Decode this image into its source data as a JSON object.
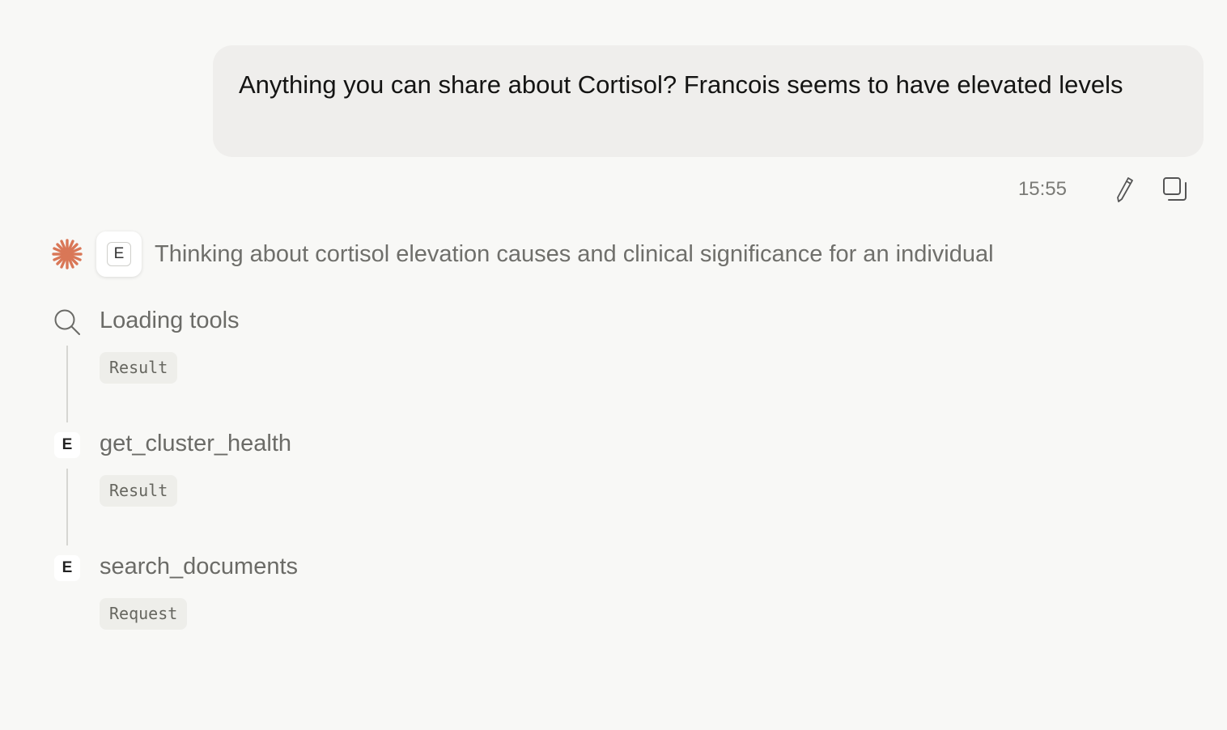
{
  "user_message": {
    "text": "Anything you can share about Cortisol? Francois seems to have elevated levels",
    "timestamp": "15:55",
    "icons": {
      "edit": "pencil-icon",
      "copy": "copy-icon"
    }
  },
  "assistant": {
    "thinking_icon_letter": "E",
    "thinking_text": "Thinking about cortisol elevation causes and clinical significance for an individual",
    "accent_color": "#d97757",
    "steps": [
      {
        "icon": "search-icon",
        "title": "Loading tools",
        "chip": "Result"
      },
      {
        "icon": "e-badge-icon",
        "icon_letter": "E",
        "title": "get_cluster_health",
        "chip": "Result"
      },
      {
        "icon": "e-badge-icon",
        "icon_letter": "E",
        "title": "search_documents",
        "chip": "Request"
      }
    ]
  }
}
